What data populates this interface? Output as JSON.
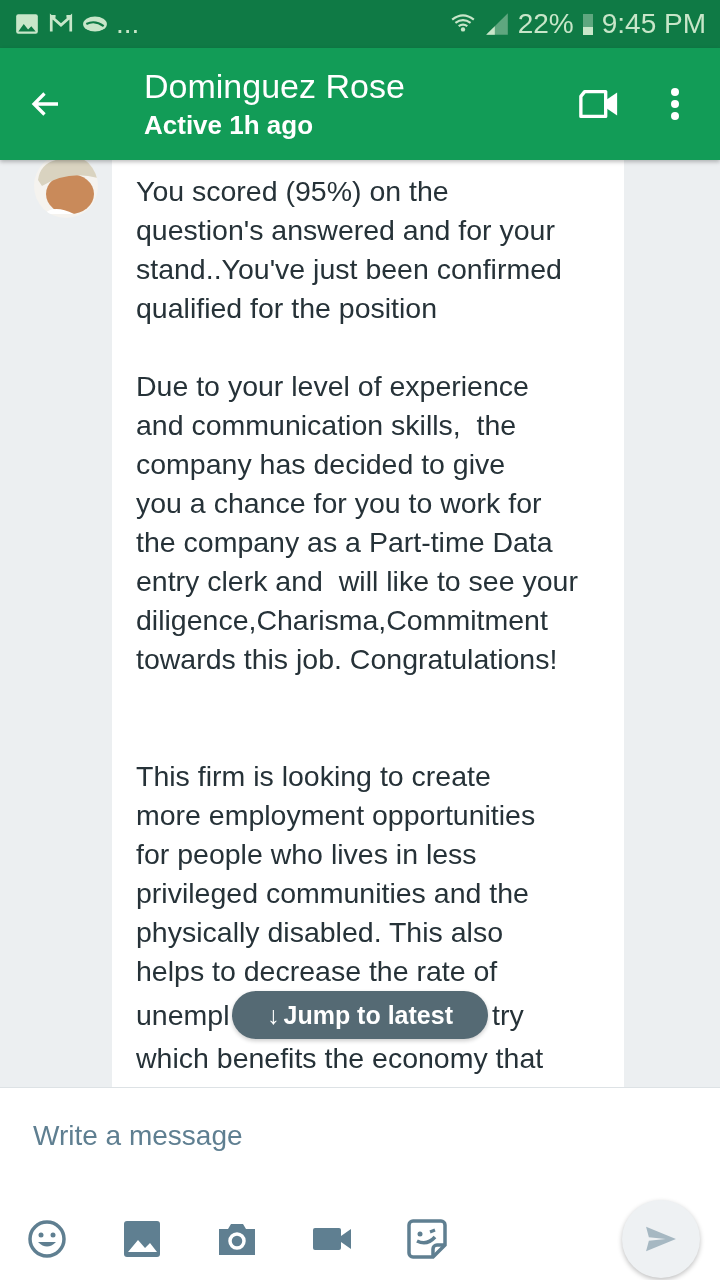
{
  "status_bar": {
    "overflow": "...",
    "battery": "22%",
    "time": "9:45 PM"
  },
  "header": {
    "title": "Dominguez Rose",
    "subtitle": "Active 1h ago"
  },
  "message": {
    "text": "You scored (95%) on the\nquestion's answered and for your\nstand..You've just been confirmed\nqualified for the position\n\nDue to your level of experience\nand communication skills,  the\ncompany has decided to give\nyou a chance for you to work for\nthe company as a Part-time Data\nentry clerk and  will like to see your\ndiligence,Charisma,Commitment\ntowards this job. Congratulations!\n\n\nThis firm is looking to create\nmore employment opportunities\nfor people who lives in less\nprivileged communities and the\nphysically disabled. This also\nhelps to decrease the rate of",
    "covered_line": {
      "left": "unempl",
      "right": "try"
    },
    "tail": "which benefits the economy that"
  },
  "jump_button": {
    "icon": "↓",
    "label": "Jump to latest"
  },
  "composer": {
    "placeholder": "Write a message"
  }
}
